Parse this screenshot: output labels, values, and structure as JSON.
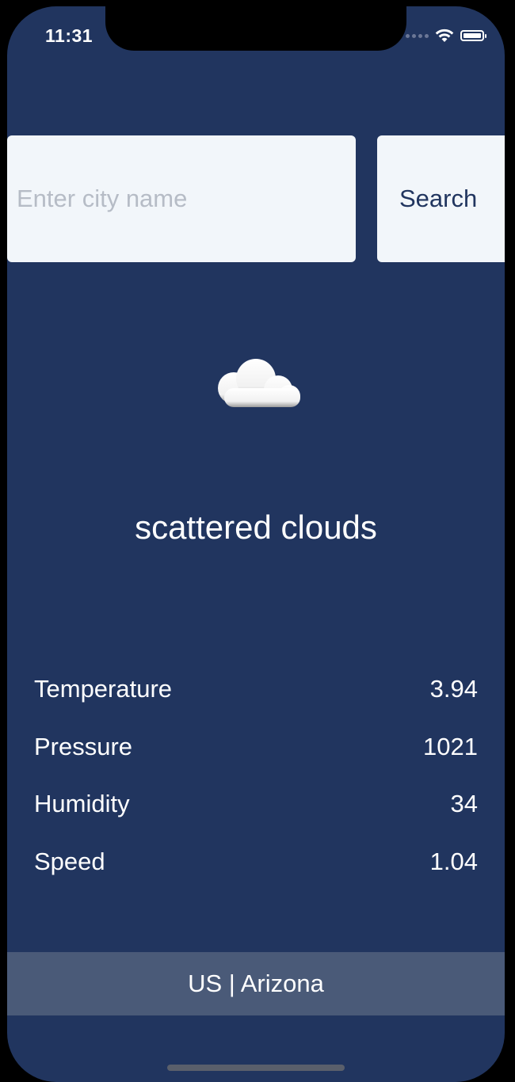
{
  "status_bar": {
    "time": "11:31",
    "icons": [
      "signal-icon",
      "wifi-icon",
      "battery-icon"
    ]
  },
  "search": {
    "placeholder": "Enter city name",
    "value": "",
    "button_label": "Search"
  },
  "weather": {
    "icon": "cloud-icon",
    "description": "scattered clouds"
  },
  "stats": [
    {
      "label": "Temperature",
      "value": "3.94"
    },
    {
      "label": "Pressure",
      "value": "1021"
    },
    {
      "label": "Humidity",
      "value": "34"
    },
    {
      "label": "Speed",
      "value": "1.04"
    }
  ],
  "location": {
    "text": "US | Arizona"
  },
  "colors": {
    "background": "#21355f",
    "field": "#f2f6fa",
    "footer": "#4a5a78",
    "text": "#ffffff"
  }
}
